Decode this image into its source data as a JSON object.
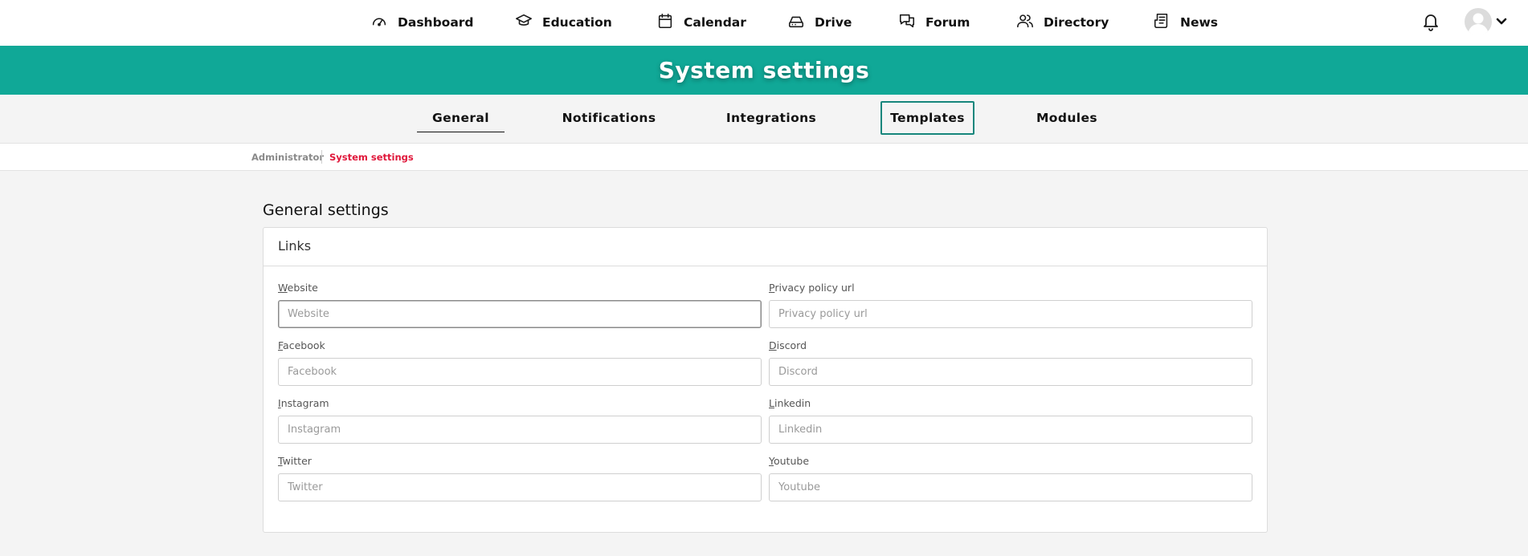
{
  "nav": {
    "items": [
      {
        "label": "Dashboard",
        "icon": "dashboard-icon"
      },
      {
        "label": "Education",
        "icon": "graduation-cap-icon"
      },
      {
        "label": "Calendar",
        "icon": "calendar-icon"
      },
      {
        "label": "Drive",
        "icon": "drive-icon"
      },
      {
        "label": "Forum",
        "icon": "forum-icon"
      },
      {
        "label": "Directory",
        "icon": "users-icon"
      },
      {
        "label": "News",
        "icon": "news-icon"
      }
    ],
    "notifications_icon": "bell-icon",
    "user_icon": "avatar-icon"
  },
  "banner": {
    "title": "System settings",
    "color": "#10a897"
  },
  "tabs": [
    {
      "label": "General",
      "active": true
    },
    {
      "label": "Notifications"
    },
    {
      "label": "Integrations"
    },
    {
      "label": "Templates",
      "focused": true
    },
    {
      "label": "Modules"
    }
  ],
  "breadcrumb": {
    "items": [
      "Administrator",
      "System settings"
    ],
    "current_color": "#e0173a"
  },
  "page": {
    "section_title": "General settings"
  },
  "card": {
    "title": "Links",
    "fields": [
      {
        "label": "Website",
        "placeholder": "Website",
        "value": ""
      },
      {
        "label": "Privacy policy url",
        "placeholder": "Privacy policy url",
        "value": ""
      },
      {
        "label": "Facebook",
        "placeholder": "Facebook",
        "value": ""
      },
      {
        "label": "Discord",
        "placeholder": "Discord",
        "value": ""
      },
      {
        "label": "Instagram",
        "placeholder": "Instagram",
        "value": ""
      },
      {
        "label": "Linkedin",
        "placeholder": "Linkedin",
        "value": ""
      },
      {
        "label": "Twitter",
        "placeholder": "Twitter",
        "value": ""
      },
      {
        "label": "Youtube",
        "placeholder": "Youtube",
        "value": ""
      }
    ]
  }
}
